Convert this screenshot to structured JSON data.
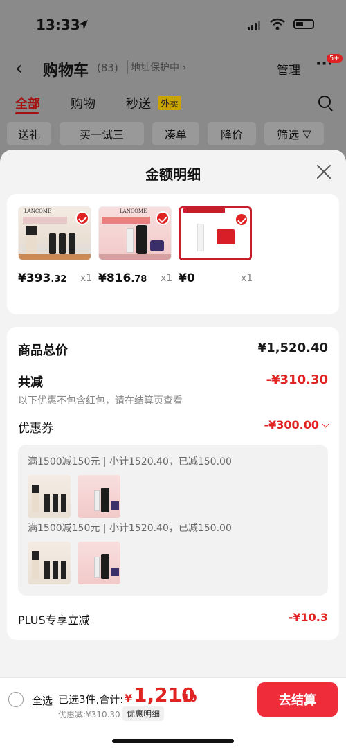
{
  "status_bar": {
    "time": "13:33"
  },
  "nav": {
    "title": "购物车",
    "count": "(83)",
    "address": "地址保护中 ›",
    "manage": "管理",
    "more": "···",
    "badge": "5+"
  },
  "tabs": [
    {
      "label": "全部"
    },
    {
      "label": "购物"
    },
    {
      "label": "秒送"
    }
  ],
  "tab_badge": "外卖",
  "chips": [
    "送礼",
    "买一试三",
    "凑单",
    "降价",
    "筛选"
  ],
  "sheet": {
    "title": "金额明细"
  },
  "products": [
    {
      "brand": "LANCOME",
      "price_int": "¥393",
      "price_dec": ".32",
      "qty": "x1"
    },
    {
      "brand": "LANCOME",
      "price_int": "¥816",
      "price_dec": ".78",
      "qty": "x1"
    },
    {
      "brand": "",
      "price_int": "¥0",
      "price_dec": "",
      "qty": "x1"
    }
  ],
  "summary": {
    "total_label": "商品总价",
    "total_value": "¥1,520.40",
    "discount_label": "共减",
    "discount_value": "-¥310.30",
    "discount_note": "以下优惠不包含红包，请在结算页查看",
    "coupon_label": "优惠券",
    "coupon_value": "-¥300.00",
    "coupon_lines": [
      "满1500减150元 | 小计1520.40，已减150.00",
      "满1500减150元 | 小计1520.40，已减150.00"
    ],
    "plus_label": "PLUS专享立减",
    "plus_value": "-¥10.3"
  },
  "bottom": {
    "select_all": "全选",
    "selected": "已选3件,合计:",
    "total_symbol": "¥",
    "total_int": "1,210",
    "total_dec": ".10",
    "discount": "优惠减:¥310.30",
    "detail": "优惠明细",
    "checkout": "去结算"
  },
  "colors": {
    "accent": "#e02323",
    "checkout": "#ef2c39",
    "tab_active": "#a41010"
  }
}
